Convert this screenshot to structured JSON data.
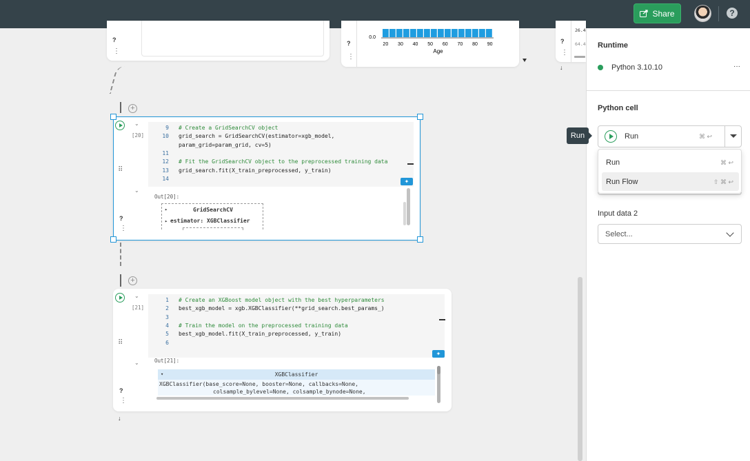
{
  "topbar": {
    "share_label": "Share",
    "share_icon": "share-icon",
    "help_icon": "help-icon"
  },
  "top_chart": {
    "y_tick": "0.0",
    "x_ticks": [
      "20",
      "30",
      "40",
      "50",
      "60",
      "70",
      "80",
      "90"
    ],
    "x_label": "Age",
    "bar_color": "#1f9de0",
    "right_values": [
      "26.4",
      "64.4"
    ]
  },
  "cell1": {
    "exec_count": "[20]",
    "lines": [
      {
        "n": "9",
        "text": "# Create a GridSearchCV object",
        "comment": true
      },
      {
        "n": "10",
        "text": "grid_search = GridSearchCV(estimator=xgb_model,",
        "comment": false
      },
      {
        "n": "",
        "text": "param_grid=param_grid, cv=5)",
        "comment": false
      },
      {
        "n": "11",
        "text": "",
        "comment": false
      },
      {
        "n": "12",
        "text": "# Fit the GridSearchCV object to the preprocessed training data",
        "comment": true
      },
      {
        "n": "13",
        "text": "grid_search.fit(X_train_preprocessed, y_train)",
        "comment": false
      },
      {
        "n": "14",
        "text": "",
        "comment": false
      }
    ],
    "out_label": "Out[20]:",
    "out_row1": "GridSearchCV",
    "out_row2": "estimator: XGBClassifier"
  },
  "cell2": {
    "exec_count": "[21]",
    "lines": [
      {
        "n": "1",
        "text": "# Create an XGBoost model object with the best hyperparameters",
        "comment": true
      },
      {
        "n": "2",
        "text": "best_xgb_model = xgb.XGBClassifier(**grid_search.best_params_)",
        "comment": false
      },
      {
        "n": "3",
        "text": "",
        "comment": false
      },
      {
        "n": "4",
        "text": "# Train the model on the preprocessed training data",
        "comment": true
      },
      {
        "n": "5",
        "text": "best_xgb_model.fit(X_train_preprocessed, y_train)",
        "comment": false
      },
      {
        "n": "6",
        "text": "",
        "comment": false
      }
    ],
    "out_label": "Out[21]:",
    "out_title": "XGBClassifier",
    "out_line1": "XGBClassifier(base_score=None, booster=None, callbacks=None,",
    "out_line2": "colsample_bylevel=None, colsample_bynode=None,"
  },
  "panel": {
    "runtime_title": "Runtime",
    "runtime_value": "Python 3.10.10",
    "runtime_more": "···",
    "cell_title": "Python cell",
    "run_label": "Run",
    "run_shortcut": "⌘ ↩",
    "tooltip": "Run",
    "menu": [
      {
        "label": "Run",
        "shortcut": "⌘ ↩"
      },
      {
        "label": "Run Flow",
        "shortcut": "⇧ ⌘ ↩"
      }
    ],
    "input2_label": "Input data 2",
    "input2_placeholder": "Select..."
  },
  "colors": {
    "topbar": "#35434a",
    "accent_green": "#2a9d5c",
    "selection_blue": "#2196d8"
  }
}
